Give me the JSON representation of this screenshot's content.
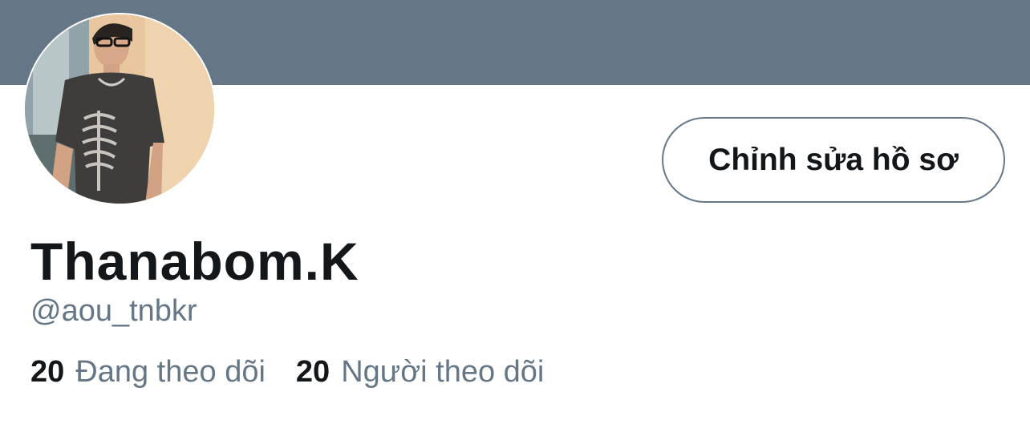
{
  "profile": {
    "display_name": "Thanabom.K",
    "handle": "@aou_tnbkr",
    "edit_button_label": "Chỉnh sửa hồ sơ",
    "following": {
      "count": "20",
      "label": "Đang theo dõi"
    },
    "followers": {
      "count": "20",
      "label": "Người theo dõi"
    }
  },
  "colors": {
    "banner": "#657786",
    "primary_text": "#14171a",
    "secondary_text": "#657786"
  },
  "icons": {
    "avatar": "profile-photo"
  }
}
